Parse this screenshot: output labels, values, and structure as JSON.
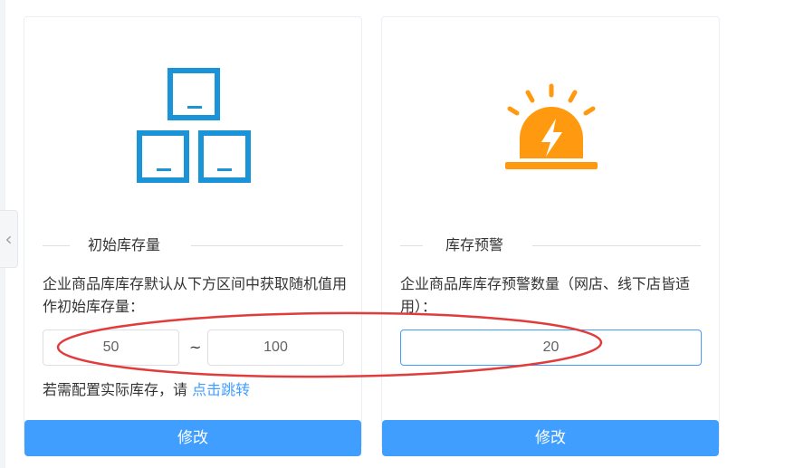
{
  "sidebar": {
    "collapse_icon": "chevron-left-icon",
    "collapse_glyph": "‹"
  },
  "cards": [
    {
      "icon": "boxes-icon",
      "title": "初始库存量",
      "description": "企业商品库库存默认从下方区间中获取随机值用作初始库存量：",
      "range_min": "50",
      "range_separator": "~",
      "range_max": "100",
      "hint_prefix": "若需配置实际库存，请 ",
      "hint_link": "点击跳转",
      "button_label": "修改"
    },
    {
      "icon": "alarm-light-icon",
      "title": "库存预警",
      "description": "企业商品库库存预警数量（网店、线下店皆适用）：",
      "threshold": "20",
      "button_label": "修改"
    }
  ],
  "colors": {
    "primary": "#409eff",
    "box_icon": "#1a94d6",
    "alarm_icon": "#ff9a10",
    "annotation_ellipse": "#e23b3b"
  }
}
